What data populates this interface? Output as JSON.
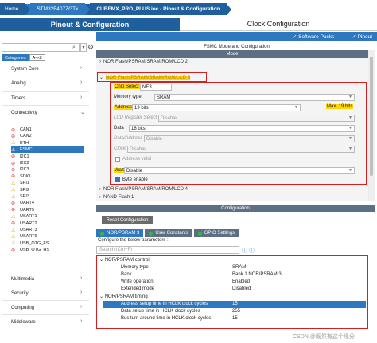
{
  "breadcrumb": {
    "home": "Home",
    "mcu": "STM32F407ZGTx",
    "file": "CUBEMX_PRO_PLUS.ioc - Pinout & Configuration"
  },
  "tabs": {
    "pinout": "Pinout & Configuration",
    "clock": "Clock Configuration"
  },
  "subbar": {
    "software_packs": "✓ Software Packs",
    "pinout": "✓ Pinout"
  },
  "left": {
    "cat_tabs": [
      "Categories",
      "A->Z"
    ],
    "categories": [
      "System Core",
      "Analog",
      "Timers",
      "Connectivity"
    ],
    "peripherals": [
      {
        "label": "CAN1",
        "mark": "⊘",
        "color": "red"
      },
      {
        "label": "CAN2",
        "mark": "⊘",
        "color": "red"
      },
      {
        "label": "ETH",
        "mark": "⚠",
        "color": "yel"
      },
      {
        "label": "FSMC",
        "mark": "⚠",
        "color": "grn",
        "selected": true
      },
      {
        "label": "I2C1",
        "mark": "⊘",
        "color": "red"
      },
      {
        "label": "I2C2",
        "mark": "⊘",
        "color": "red"
      },
      {
        "label": "I2C3",
        "mark": "⊘",
        "color": "red"
      },
      {
        "label": "SDIO",
        "mark": "⊘",
        "color": "red"
      },
      {
        "label": "SPI1",
        "mark": "⚠",
        "color": "yel"
      },
      {
        "label": "SPI2",
        "mark": "⚠",
        "color": "yel"
      },
      {
        "label": "SPI3",
        "mark": "⚠",
        "color": "yel"
      },
      {
        "label": "UART4",
        "mark": "⊘",
        "color": "red"
      },
      {
        "label": "UART5",
        "mark": "⊘",
        "color": "red"
      },
      {
        "label": "USART1",
        "mark": "⚠",
        "color": "yel"
      },
      {
        "label": "USART2",
        "mark": "⊘",
        "color": "red"
      },
      {
        "label": "USART3",
        "mark": "⚠",
        "color": "yel"
      },
      {
        "label": "USART6",
        "mark": "⚠",
        "color": "yel"
      },
      {
        "label": "USB_OTG_FS",
        "mark": "⚠",
        "color": "yel"
      },
      {
        "label": "USB_OTG_HS",
        "mark": "⊘",
        "color": "red"
      }
    ],
    "bottom_categories": [
      "Multimedia",
      "Security",
      "Computing",
      "Middleware"
    ]
  },
  "mode": {
    "title": "FSMC Mode and Configuration",
    "bar": "Mode",
    "node_top": "NOR Flash/PSRAM/SRAM/ROM/LCD 2",
    "node_sel": "NOR Flash/PSRAM/SRAM/ROM/LCD 3",
    "rows": {
      "chip_select": {
        "label": "Chip Select",
        "value": "NE3"
      },
      "memory_type": {
        "label": "Memory type",
        "value": "SRAM"
      },
      "address": {
        "label": "Address",
        "value": "19 bits",
        "max": "Max. 19 bits"
      },
      "lcd_rs": {
        "label": "LCD Register Select",
        "value": "Disable"
      },
      "data": {
        "label": "Data",
        "value": "16 bits"
      },
      "data_address": {
        "label": "Data/Address",
        "value": "Disable"
      },
      "clock": {
        "label": "Clock",
        "value": "Disable"
      },
      "address_valid": {
        "label": "Address valid"
      },
      "wait": {
        "label": "Wait",
        "value": "Disable"
      },
      "byte_enable": {
        "label": "Byte enable"
      }
    },
    "node_4": "NOR Flash/PSRAM/SRAM/ROM/LCD 4",
    "node_nand": "NAND Flash 1"
  },
  "config": {
    "bar": "Configuration",
    "reset": "Reset Configuration",
    "tabs": [
      "NOR/PSRAM 3",
      "User Constants",
      "GPIO Settings"
    ],
    "configure_text": "Configure the below parameters :",
    "search_placeholder": "Search (Ctrl+F)",
    "group1": "NOR/PSRAM control",
    "params1": [
      {
        "name": "Memory type",
        "value": "SRAM"
      },
      {
        "name": "Bank",
        "value": "Bank 1 NOR/PSRAM 3"
      },
      {
        "name": "Write operation",
        "value": "Enabled"
      },
      {
        "name": "Extended mode",
        "value": "Disabled"
      }
    ],
    "group2": "NOR/PSRAM timing",
    "params2": [
      {
        "name": "Address setup time in HCLK clock cycles",
        "value": "15"
      },
      {
        "name": "Data setup time in HCLK clock cycles",
        "value": "255"
      },
      {
        "name": "Bus turn around time in HCLK clock cycles",
        "value": "15"
      }
    ]
  },
  "watermark": "CSDN @既然有这个缘分"
}
